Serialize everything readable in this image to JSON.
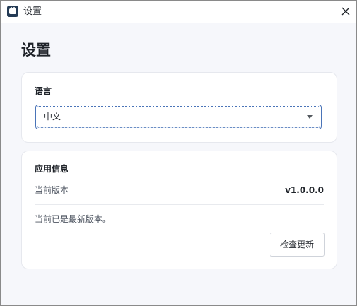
{
  "window": {
    "title": "设置",
    "app_icon": "calendar-icon",
    "close_icon": "close-icon"
  },
  "page": {
    "title": "设置"
  },
  "language": {
    "label": "语言",
    "selected": "中文"
  },
  "app_info": {
    "label": "应用信息",
    "version_label": "当前版本",
    "version_value": "v1.0.0.0",
    "status_text": "当前已是最新版本。",
    "check_update_label": "检查更新"
  },
  "colors": {
    "background": "#f6f7fb",
    "card": "#ffffff",
    "accent": "#4a74b8",
    "text": "#1f2329",
    "muted_text": "#4e5561"
  }
}
